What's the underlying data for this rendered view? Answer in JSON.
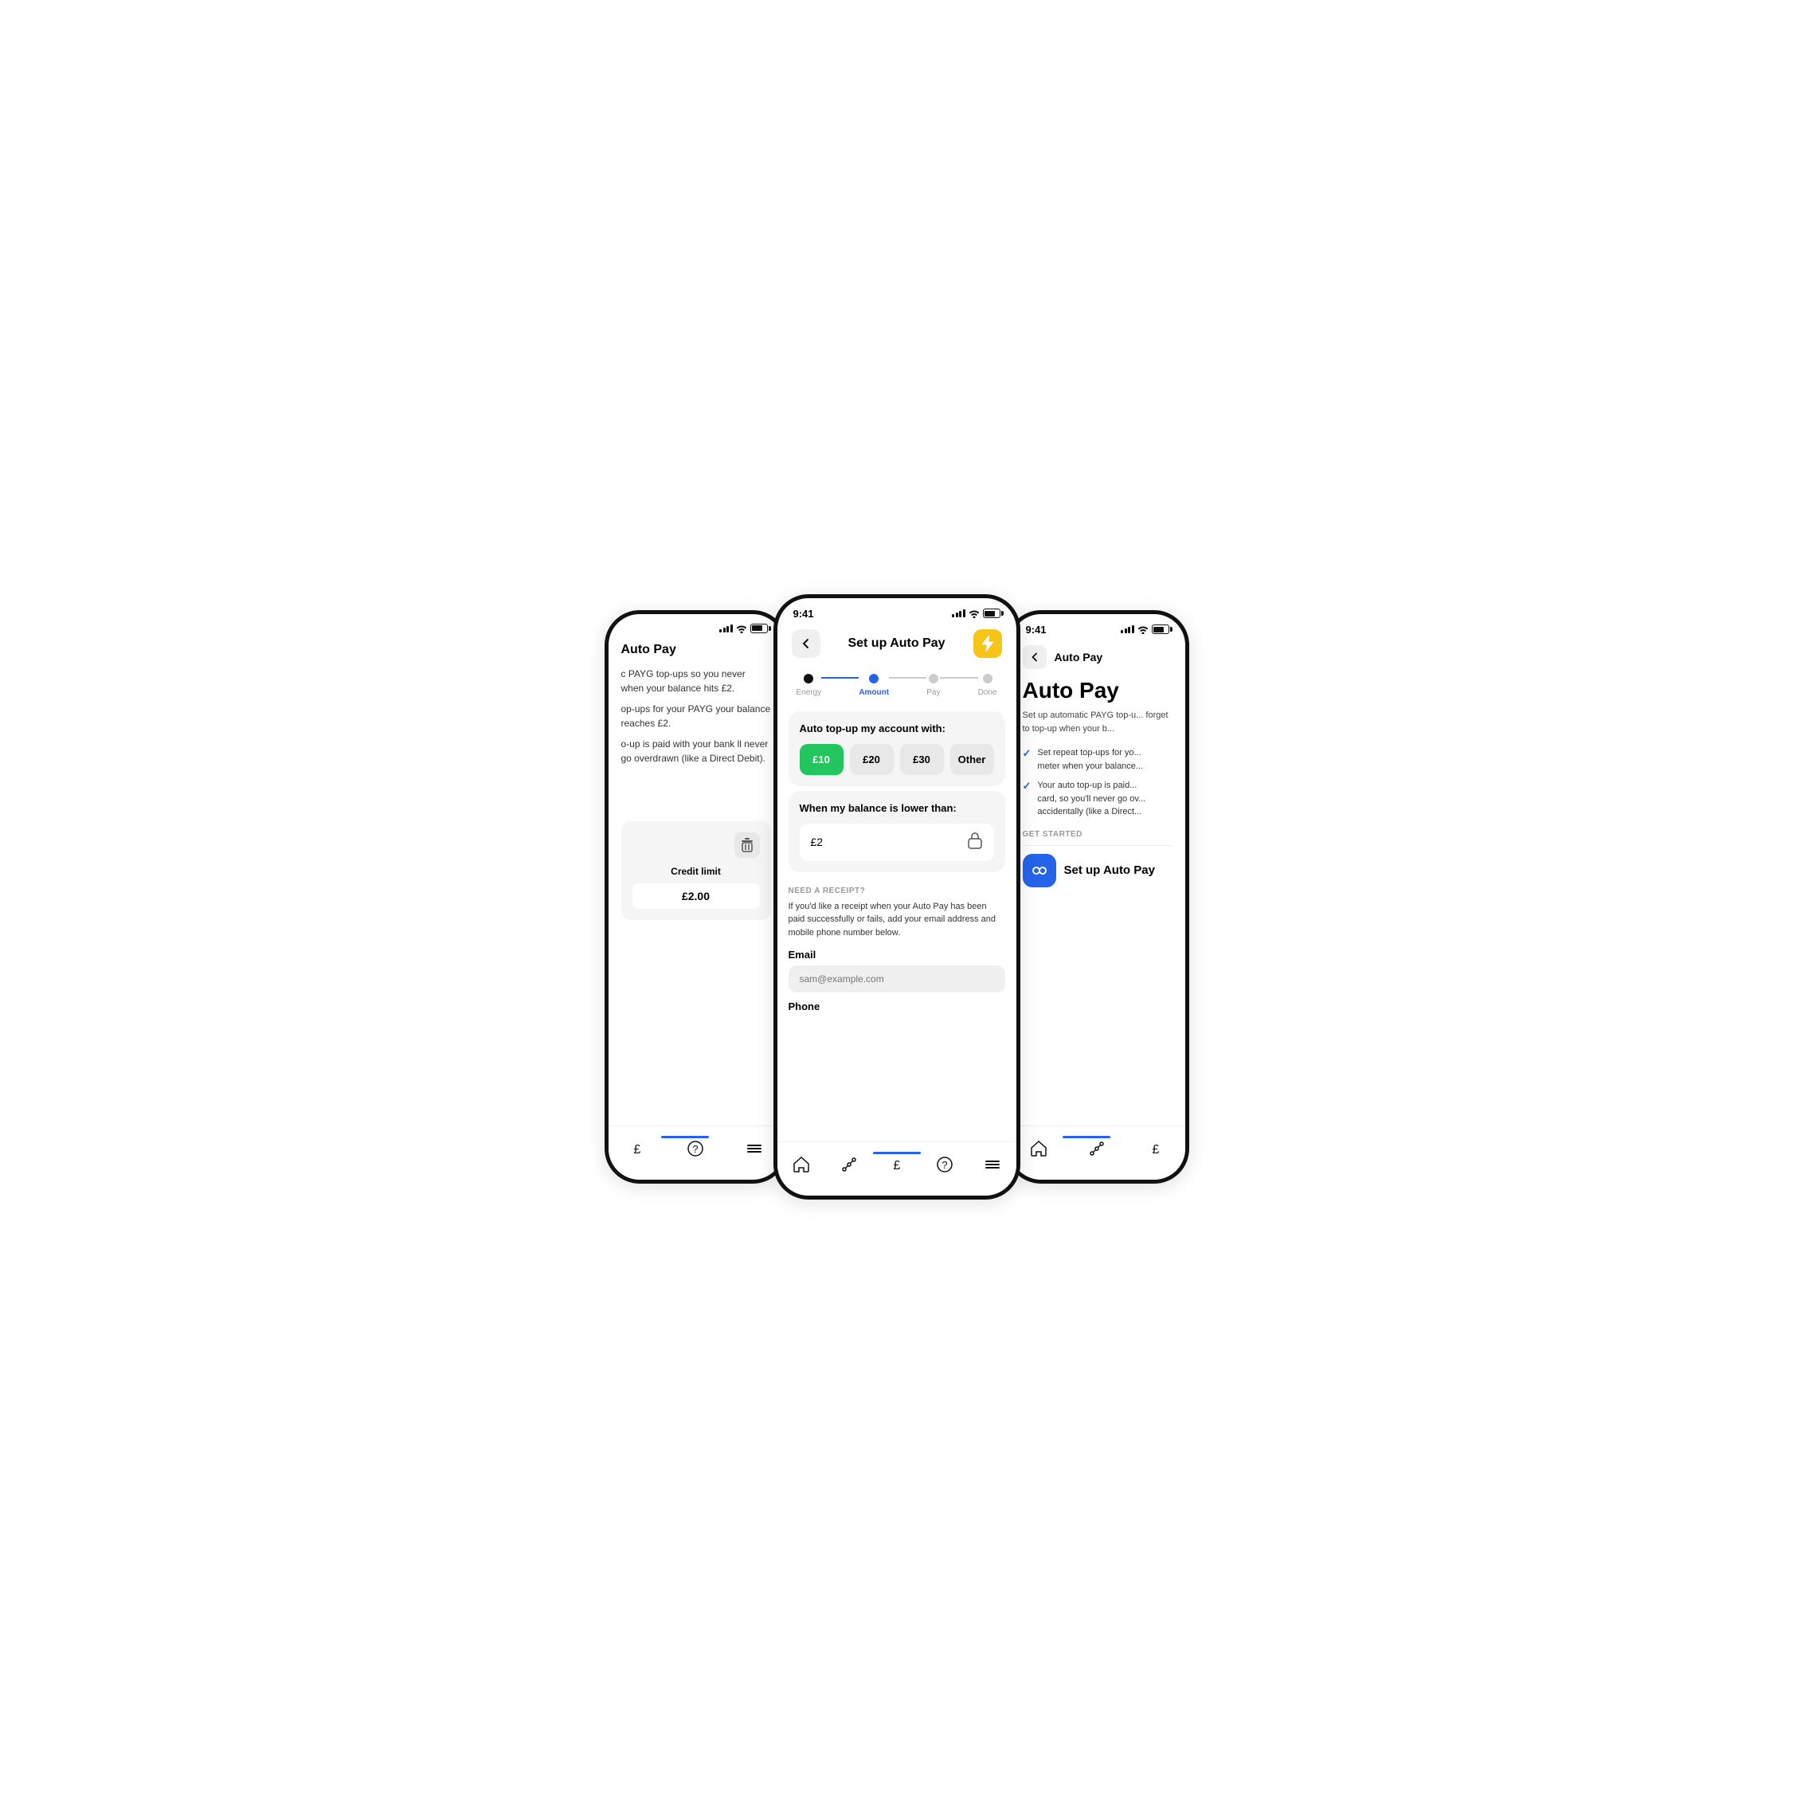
{
  "scene": {
    "bg": "#ffffff"
  },
  "left_phone": {
    "header": "Auto Pay",
    "body1": "c PAYG top-ups so you never\nwhen your balance hits £2.",
    "body2": "op-ups for your PAYG\nyour balance reaches £2.",
    "body3": "o-up is paid with your bank\nll never go overdrawn\n(like a Direct Debit).",
    "credit_limit_label": "Credit limit",
    "credit_limit_value": "£2.00",
    "nav_indicator_left": "30%"
  },
  "center_phone": {
    "status_time": "9:41",
    "title": "Set up Auto Pay",
    "steps": [
      {
        "label": "Energy",
        "state": "completed"
      },
      {
        "label": "Amount",
        "state": "active"
      },
      {
        "label": "Pay",
        "state": "default"
      },
      {
        "label": "Done",
        "state": "default"
      }
    ],
    "card1": {
      "title": "Auto top-up my account with:",
      "options": [
        {
          "label": "£10",
          "selected": true
        },
        {
          "label": "£20",
          "selected": false
        },
        {
          "label": "£30",
          "selected": false
        },
        {
          "label": "Other",
          "selected": false
        }
      ]
    },
    "card2": {
      "title": "When my balance is lower than:",
      "balance": "£2"
    },
    "receipt": {
      "label": "NEED A RECEIPT?",
      "desc": "If you'd like a receipt when your Auto Pay has been paid successfully or fails, add your email address and mobile phone number below.",
      "email_label": "Email",
      "email_placeholder": "sam@example.com",
      "phone_label": "Phone"
    },
    "nav_items": [
      "home",
      "graph",
      "account",
      "help",
      "menu"
    ]
  },
  "right_phone": {
    "status_time": "9:41",
    "header": "Auto Pay",
    "autopay_heading": "Auto Pay",
    "desc": "Set up automatic PAYG top-u...\nforget to top-up when your b...",
    "check_items": [
      "Set repeat top-ups for yo...\nmeter when your balance...",
      "Your auto top-up is paid...\ncard, so you'll never go ov...\naccidentally (like a Direct..."
    ],
    "get_started_label": "GET STARTED",
    "setup_label": "Set up Auto Pay",
    "nav_items": [
      "home",
      "graph",
      "account"
    ]
  },
  "icons": {
    "back_arrow": "←",
    "lightning": "⚡",
    "trash": "🗑",
    "lock": "🔒",
    "infinity": "∞",
    "check": "✓",
    "home": "⌂",
    "help": "?",
    "menu": "≡"
  },
  "colors": {
    "accent_blue": "#2563eb",
    "accent_green": "#22c55e",
    "accent_yellow": "#f5c518",
    "nav_bar": "#2196F3",
    "bg_card": "#f5f5f5",
    "text_primary": "#111",
    "text_secondary": "#666"
  }
}
